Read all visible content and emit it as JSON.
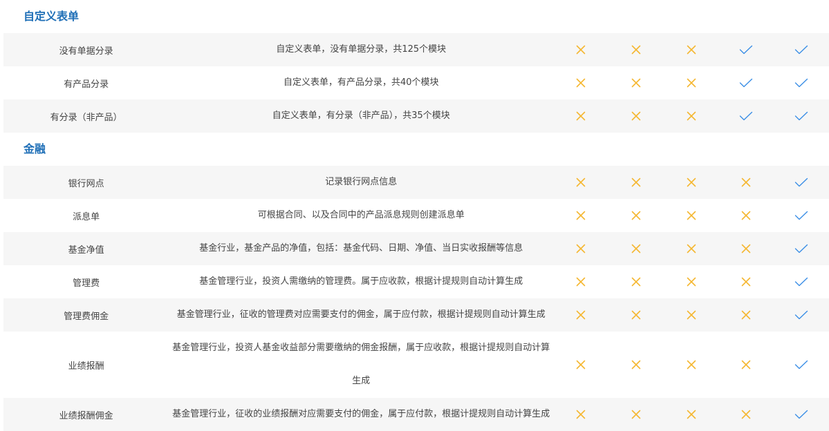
{
  "sections": [
    {
      "title": "自定义表单",
      "rows": [
        {
          "name": "没有单据分录",
          "desc": "自定义表单，没有单据分录，共125个模块",
          "marks": [
            "x",
            "x",
            "x",
            "check",
            "check"
          ]
        },
        {
          "name": "有产品分录",
          "desc": "自定义表单，有产品分录，共40个模块",
          "marks": [
            "x",
            "x",
            "x",
            "check",
            "check"
          ]
        },
        {
          "name": "有分录（非产品）",
          "desc": "自定义表单，有分录（非产品），共35个模块",
          "marks": [
            "x",
            "x",
            "x",
            "check",
            "check"
          ]
        }
      ]
    },
    {
      "title": "金融",
      "rows": [
        {
          "name": "银行网点",
          "desc": "记录银行网点信息",
          "marks": [
            "x",
            "x",
            "x",
            "x",
            "check"
          ]
        },
        {
          "name": "派息单",
          "desc": "可根据合同、以及合同中的产品派息规则创建派息单",
          "marks": [
            "x",
            "x",
            "x",
            "x",
            "check"
          ]
        },
        {
          "name": "基金净值",
          "desc": "基金行业，基金产品的净值，包括：基金代码、日期、净值、当日实收报酬等信息",
          "marks": [
            "x",
            "x",
            "x",
            "x",
            "check"
          ]
        },
        {
          "name": "管理费",
          "desc": "基金管理行业，投资人需缴纳的管理费。属于应收款，根据计提规则自动计算生成",
          "marks": [
            "x",
            "x",
            "x",
            "x",
            "check"
          ]
        },
        {
          "name": "管理费佣金",
          "desc": "基金管理行业，征收的管理费对应需要支付的佣金，属于应付款，根据计提规则自动计算生成",
          "marks": [
            "x",
            "x",
            "x",
            "x",
            "check"
          ]
        },
        {
          "name": "业绩报酬",
          "desc": "基金管理行业，投资人基金收益部分需要缴纳的佣金报酬，属于应收款，根据计提规则自动计算生成",
          "desc_line1": "基金管理行业，投资人基金收益部分需要缴纳的佣金报酬，属于应收款，根据计提规则自动计算",
          "desc_line2": "生成",
          "marks": [
            "x",
            "x",
            "x",
            "x",
            "check"
          ]
        },
        {
          "name": "业绩报酬佣金",
          "desc": "基金管理行业，征收的业绩报酬对应需要支付的佣金，属于应付款，根据计提规则自动计算生成",
          "marks": [
            "x",
            "x",
            "x",
            "x",
            "check"
          ]
        }
      ]
    }
  ],
  "colors": {
    "title": "#1f6fb7",
    "x_mark": "#f5b731",
    "check_mark": "#3a8ee6",
    "row_bg": "#f6f6f6"
  },
  "icons": {
    "x": "cross-icon",
    "check": "check-icon"
  }
}
